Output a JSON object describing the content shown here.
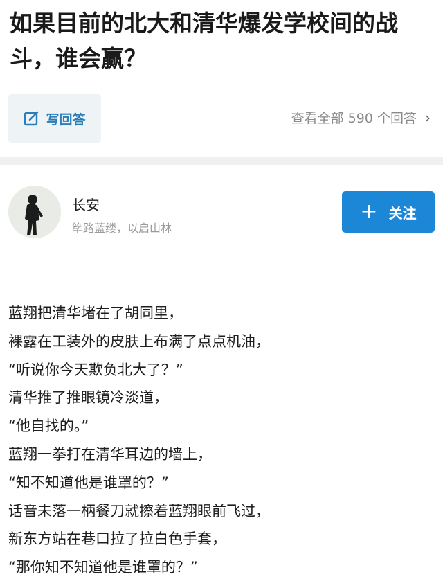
{
  "question": {
    "title": "如果目前的北大和清华爆发学校间的战斗，谁会赢？"
  },
  "actions": {
    "write_answer_label": "写回答",
    "view_all_label": "查看全部 590 个回答",
    "chevron": "›"
  },
  "author": {
    "name": "长安",
    "bio": "筚路蓝缕，以启山林",
    "follow_label": "关注",
    "follow_icon": "+"
  },
  "answer": {
    "lines": [
      "蓝翔把清华堵在了胡同里，",
      "裸露在工装外的皮肤上布满了点点机油，",
      "“听说你今天欺负北大了？”",
      "清华推了推眼镜冷淡道，",
      "“他自找的。”",
      "蓝翔一拳打在清华耳边的墙上，",
      "“知不知道他是谁罩的？”",
      "话音未落一柄餐刀就擦着蓝翔眼前飞过，",
      "新东方站在巷口拉了拉白色手套，",
      "“那你知不知道他是谁罩的？”"
    ]
  },
  "colors": {
    "accent_blue": "#1b87d6",
    "link_blue": "#2a7db8",
    "muted_text": "#8a8a8a"
  }
}
